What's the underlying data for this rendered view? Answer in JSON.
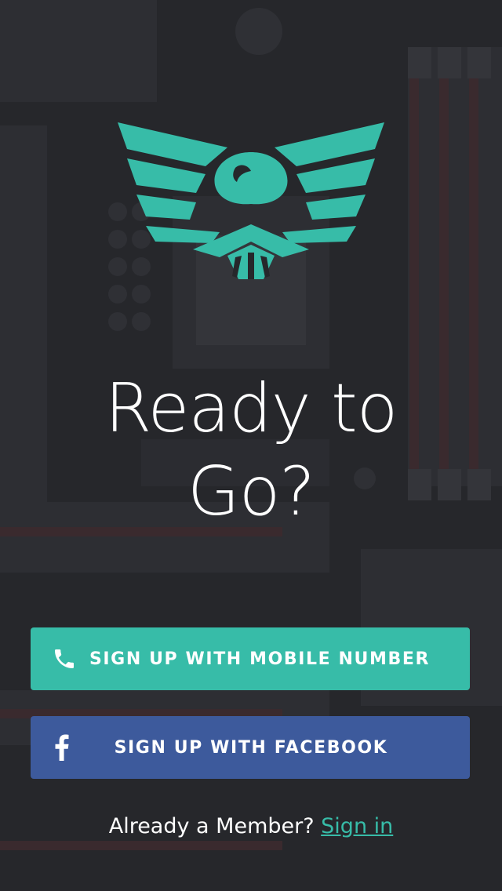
{
  "colors": {
    "accent": "#37bca8",
    "facebook": "#3d5a9c",
    "background": "#26272b"
  },
  "logo": {
    "icon": "eagle-wings-icon"
  },
  "headline": {
    "line1": "Ready to",
    "line2": "Go?"
  },
  "buttons": {
    "mobile": {
      "label": "SIGN UP WITH MOBILE NUMBER",
      "icon": "phone-icon"
    },
    "facebook": {
      "label": "SIGN UP WITH FACEBOOK",
      "icon": "facebook-icon"
    }
  },
  "footer": {
    "prompt": "Already a Member?",
    "link": "Sign in"
  }
}
